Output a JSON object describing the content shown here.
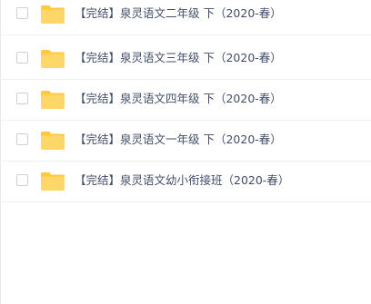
{
  "files": [
    {
      "name": "【完结】泉灵语文二年级 下（2020-春）",
      "icon": "folder-icon"
    },
    {
      "name": "【完结】泉灵语文三年级 下（2020-春）",
      "icon": "folder-icon"
    },
    {
      "name": "【完结】泉灵语文四年级 下（2020-春）",
      "icon": "folder-icon"
    },
    {
      "name": "【完结】泉灵语文一年级 下（2020-春）",
      "icon": "folder-icon"
    },
    {
      "name": "【完结】泉灵语文幼小衔接班（2020-春）",
      "icon": "folder-icon"
    }
  ],
  "colors": {
    "folder": "#FFD766",
    "folder_tab": "#FFC83D",
    "text": "#424E67",
    "border": "#F0F0F0"
  }
}
